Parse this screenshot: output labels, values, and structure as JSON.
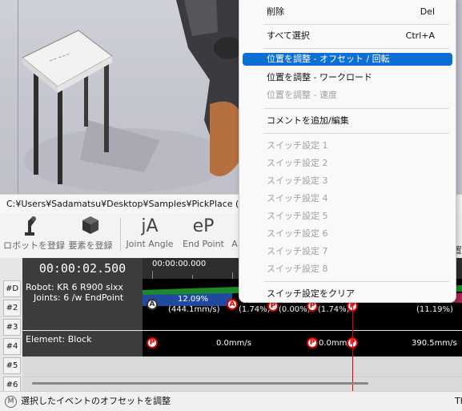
{
  "window": {
    "file_path": "C:¥Users¥Sadamatsu¥Desktop¥Samples¥PickPlace (Blo"
  },
  "toolbar": {
    "buttons": [
      {
        "label": "ロボットを登録",
        "icon": "robot-arm-icon"
      },
      {
        "label": "要素を登録",
        "icon": "cube-icon"
      },
      {
        "label": "Joint Angle",
        "icon": "jA"
      },
      {
        "label": "End Point",
        "icon": "eP"
      },
      {
        "label": "A",
        "icon": ""
      }
    ],
    "right_clip": "置"
  },
  "timeline": {
    "current_time": "00:00:02.500",
    "ruler_start": "00:00:00.000",
    "row_numbers": [
      "#D",
      "#2",
      "#3",
      "#4",
      "#5",
      "#6"
    ],
    "robot_track": {
      "name": "Robot: KR 6 R900 sixx",
      "joints": "Joints: 6 /w EndPoint",
      "segment_labels": [
        "12.09%",
        "(444.1mm/s)",
        "(1.74%)",
        "(0.00%)",
        "(1.74%)",
        "(11.19%)"
      ],
      "markers": [
        "A",
        "A",
        "P",
        "P",
        "P",
        "P"
      ]
    },
    "element_track": {
      "name": "Element: Block",
      "speed_labels": [
        "0.0mm/s",
        "0.0mm/s",
        "390.5mm/s"
      ],
      "markers": [
        "P",
        "P",
        "P"
      ]
    }
  },
  "context_menu": {
    "items": [
      {
        "label": "削除",
        "shortcut": "Del",
        "enabled": true
      },
      {
        "label": "すべて選択",
        "shortcut": "Ctrl+A",
        "enabled": true
      },
      {
        "label": "位置を調整 - オフセット / 回転",
        "shortcut": "",
        "enabled": true,
        "highlighted": true
      },
      {
        "label": "位置を調整 - ワークロード",
        "shortcut": "",
        "enabled": true
      },
      {
        "label": "位置を調整 - 速度",
        "shortcut": "",
        "enabled": false
      },
      {
        "label": "コメントを追加/編集",
        "shortcut": "",
        "enabled": true
      },
      {
        "label": "スイッチ設定 1",
        "shortcut": "",
        "enabled": false
      },
      {
        "label": "スイッチ設定 2",
        "shortcut": "",
        "enabled": false
      },
      {
        "label": "スイッチ設定 3",
        "shortcut": "",
        "enabled": false
      },
      {
        "label": "スイッチ設定 4",
        "shortcut": "",
        "enabled": false
      },
      {
        "label": "スイッチ設定 5",
        "shortcut": "",
        "enabled": false
      },
      {
        "label": "スイッチ設定 6",
        "shortcut": "",
        "enabled": false
      },
      {
        "label": "スイッチ設定 7",
        "shortcut": "",
        "enabled": false
      },
      {
        "label": "スイッチ設定 8",
        "shortcut": "",
        "enabled": false
      },
      {
        "label": "スイッチ設定をクリア",
        "shortcut": "",
        "enabled": true
      }
    ]
  },
  "statusbar": {
    "icon_letter": "M",
    "text": "選択したイベントのオフセットを調整",
    "right_clip": "Th"
  },
  "colors": {
    "highlight": "#0b6fd3",
    "marker_red": "#dd0000",
    "track_bg": "#000000",
    "header_bg": "#3c3c3c"
  }
}
